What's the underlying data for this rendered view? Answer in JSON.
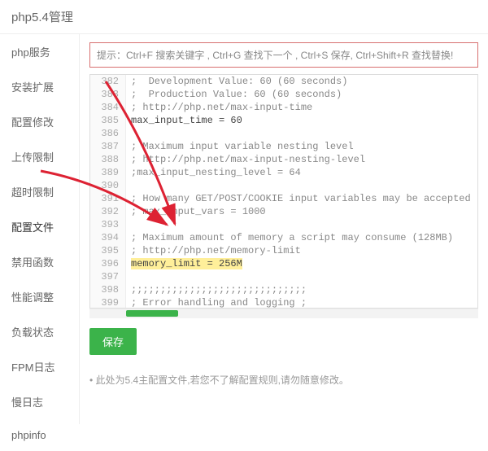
{
  "header": {
    "title": "php5.4管理"
  },
  "sidebar": {
    "items": [
      {
        "label": "php服务"
      },
      {
        "label": "安装扩展"
      },
      {
        "label": "配置修改"
      },
      {
        "label": "上传限制"
      },
      {
        "label": "超时限制"
      },
      {
        "label": "配置文件",
        "active": true
      },
      {
        "label": "禁用函数"
      },
      {
        "label": "性能调整"
      },
      {
        "label": "负载状态"
      },
      {
        "label": "FPM日志"
      },
      {
        "label": "慢日志"
      },
      {
        "label": "phpinfo"
      }
    ]
  },
  "hint": "提示：Ctrl+F 搜索关键字 , Ctrl+G 查找下一个 , Ctrl+S 保存, Ctrl+Shift+R 查找替换!",
  "editor": {
    "lines": [
      {
        "n": "382",
        "text": ";  Development Value: 60 (60 seconds)",
        "cls": "cm-comment"
      },
      {
        "n": "383",
        "text": ";  Production Value: 60 (60 seconds)",
        "cls": "cm-comment"
      },
      {
        "n": "384",
        "text": "; http://php.net/max-input-time",
        "cls": "cm-comment"
      },
      {
        "n": "385",
        "text": "max_input_time = 60",
        "cls": "cm-kw"
      },
      {
        "n": "386",
        "text": "",
        "cls": ""
      },
      {
        "n": "387",
        "text": "; Maximum input variable nesting level",
        "cls": "cm-comment"
      },
      {
        "n": "388",
        "text": "; http://php.net/max-input-nesting-level",
        "cls": "cm-comment"
      },
      {
        "n": "389",
        "text": ";max_input_nesting_level = 64",
        "cls": "cm-comment"
      },
      {
        "n": "390",
        "text": "",
        "cls": ""
      },
      {
        "n": "391",
        "text": "; How many GET/POST/COOKIE input variables may be accepted",
        "cls": "cm-comment"
      },
      {
        "n": "392",
        "text": "; max_input_vars = 1000",
        "cls": "cm-comment"
      },
      {
        "n": "393",
        "text": "",
        "cls": ""
      },
      {
        "n": "394",
        "text": "; Maximum amount of memory a script may consume (128MB)",
        "cls": "cm-comment"
      },
      {
        "n": "395",
        "text": "; http://php.net/memory-limit",
        "cls": "cm-comment"
      },
      {
        "n": "396",
        "text": "memory_limit = 256M",
        "cls": "cm-kw",
        "highlight": true
      },
      {
        "n": "397",
        "text": "",
        "cls": ""
      },
      {
        "n": "398",
        "text": ";;;;;;;;;;;;;;;;;;;;;;;;;;;;;;",
        "cls": "cm-comment"
      },
      {
        "n": "399",
        "text": "; Error handling and logging ;",
        "cls": "cm-comment"
      }
    ]
  },
  "buttons": {
    "save": "保存"
  },
  "note": "此处为5.4主配置文件,若您不了解配置规则,请勿随意修改。"
}
